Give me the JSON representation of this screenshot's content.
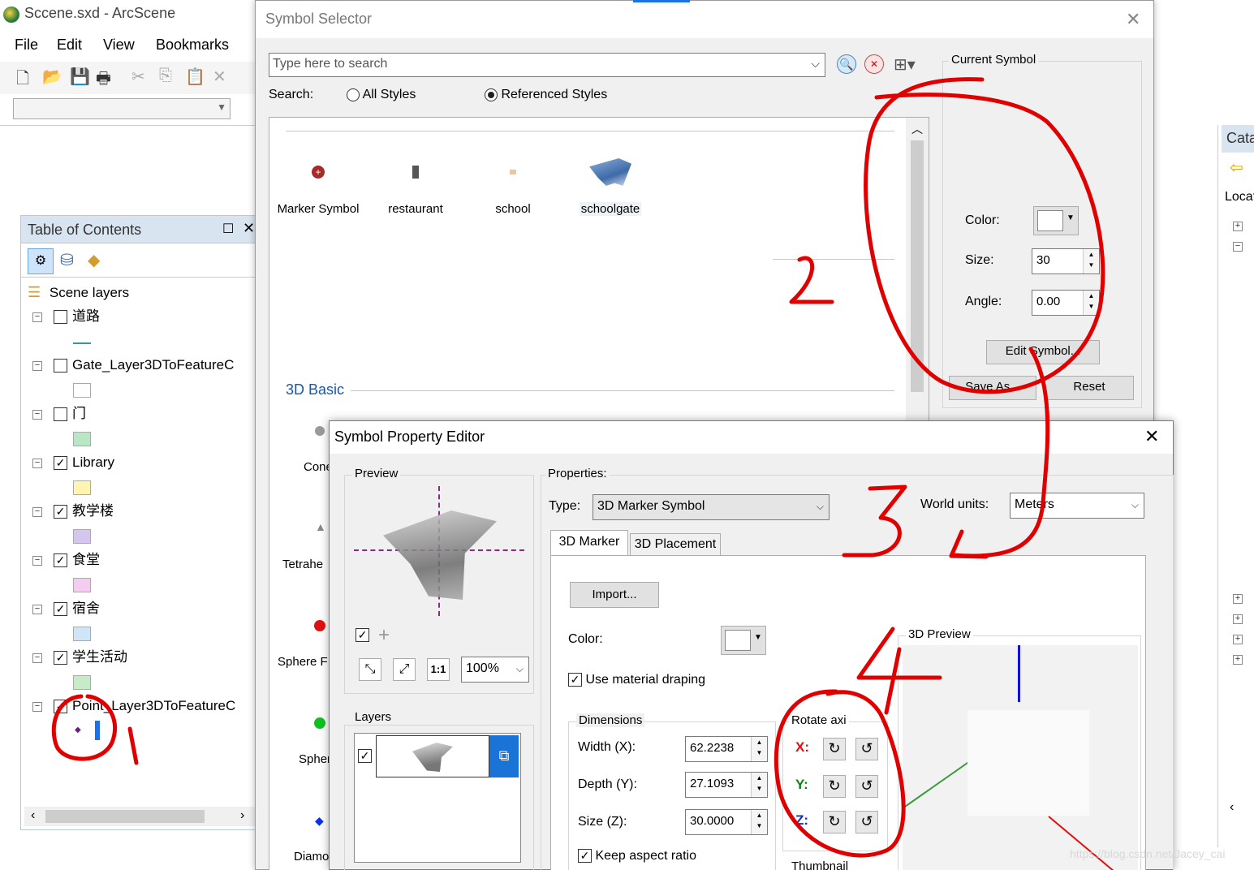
{
  "app": {
    "title": "Sccene.sxd - ArcScene",
    "menu": [
      "File",
      "Edit",
      "View",
      "Bookmarks"
    ]
  },
  "toc": {
    "title": "Table of Contents",
    "root": "Scene layers",
    "layers": [
      {
        "label": "道路",
        "checked": false
      },
      {
        "label": "Gate_Layer3DToFeatureC",
        "checked": false
      },
      {
        "label": "门",
        "checked": false
      },
      {
        "label": "Library",
        "checked": true
      },
      {
        "label": "教学楼",
        "checked": true
      },
      {
        "label": "食堂",
        "checked": true
      },
      {
        "label": "宿舍",
        "checked": true
      },
      {
        "label": "学生活动",
        "checked": true
      },
      {
        "label": "Point_Layer3DToFeatureC",
        "checked": true
      }
    ],
    "swatch_colors": [
      "#2e9e8e",
      "#ffffff",
      "#b9e6c4",
      "#fff4b0",
      "#d5c6f0",
      "#f3ccf0",
      "#cfe6f8",
      "#c6ecc7"
    ]
  },
  "catalog": {
    "tab_label": "Cata",
    "location_label": "Locat"
  },
  "symbol_selector": {
    "title": "Symbol Selector",
    "search_placeholder": "Type here to search",
    "search_label": "Search:",
    "option_all": "All Styles",
    "option_referenced": "Referenced Styles",
    "selected_option": "Referenced Styles",
    "symbols": [
      "Marker Symbol",
      "restaurant",
      "school",
      "schoolgate"
    ],
    "group_3d_basic": "3D Basic",
    "basic_items": [
      "Cone",
      "Tetrahe",
      "Sphere F",
      "Spher",
      "Diamo"
    ],
    "current_symbol_title": "Current Symbol",
    "color_label": "Color:",
    "size_label": "Size:",
    "size_value": "30",
    "angle_label": "Angle:",
    "angle_value": "0.00",
    "edit_symbol": "Edit Symbol...",
    "save_as": "Save As...",
    "reset": "Reset"
  },
  "property_editor": {
    "title": "Symbol Property Editor",
    "preview_label": "Preview",
    "zoom_value": "100%",
    "layers_label": "Layers",
    "properties_label": "Properties:",
    "type_label": "Type:",
    "type_value": "3D Marker Symbol",
    "world_units_label": "World units:",
    "world_units_value": "Meters",
    "tabs": [
      "3D Marker",
      "3D Placement"
    ],
    "import_button": "Import...",
    "color_label": "Color:",
    "use_material_draping": "Use material draping",
    "dimensions_label": "Dimensions",
    "width_label": "Width (X):",
    "width_value": "62.2238",
    "depth_label": "Depth (Y):",
    "depth_value": "27.1093",
    "size_label": "Size (Z):",
    "size_value": "30.0000",
    "keep_aspect": "Keep aspect ratio",
    "rotate_axis_label": "Rotate axi",
    "axis_x": "X:",
    "axis_y": "Y:",
    "axis_z": "Z:",
    "preview_3d_label": "3D Preview",
    "thumbnail_label": "Thumbnail"
  },
  "annotations": [
    "1",
    "2",
    "3",
    "4"
  ],
  "watermark": "https://blog.csdn.net/Jacey_cai"
}
